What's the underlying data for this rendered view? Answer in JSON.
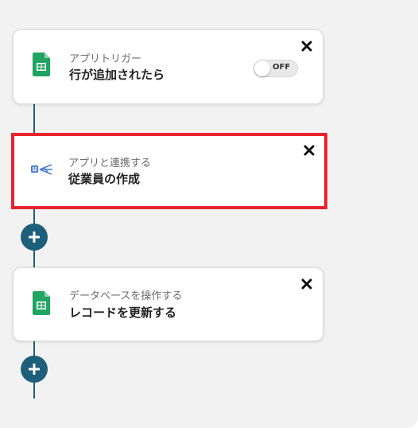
{
  "flow": {
    "steps": [
      {
        "subtitle": "アプリトリガー",
        "title": "行が追加されたら",
        "icon": "google-sheets-icon",
        "toggle_label": "OFF",
        "toggle_state": "off"
      },
      {
        "subtitle": "アプリと連携する",
        "title": "従業員の作成",
        "icon": "hr-app-icon",
        "highlighted": true
      },
      {
        "subtitle": "データベースを操作する",
        "title": "レコードを更新する",
        "icon": "google-sheets-icon"
      }
    ],
    "colors": {
      "connector": "#1d5f7a",
      "add_button": "#1d5f7a",
      "highlight_border": "#e8232f",
      "sheets_green": "#1fa463"
    },
    "close_icon": "close-icon",
    "add_icon": "plus-icon"
  }
}
